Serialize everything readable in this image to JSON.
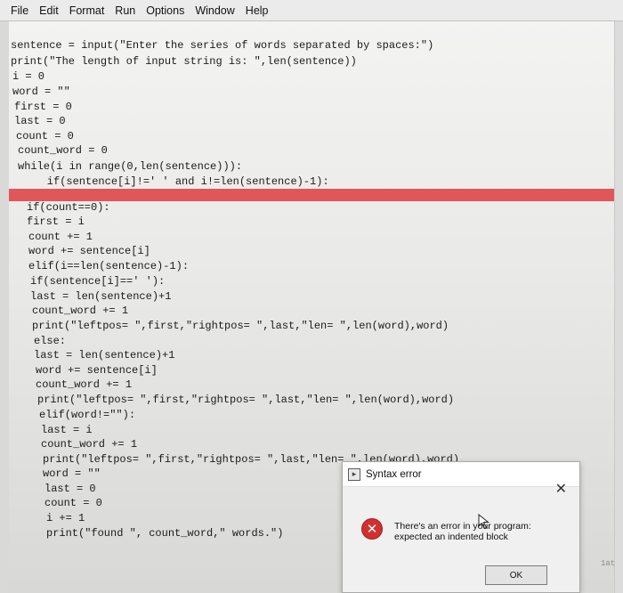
{
  "menubar": {
    "items": [
      "File",
      "Edit",
      "Format",
      "Run",
      "Options",
      "Window",
      "Help"
    ]
  },
  "code": {
    "lines": [
      "sentence = input(\"Enter the series of words separated by spaces:\")",
      "print(\"The length of input string is: \",len(sentence))",
      "i = 0",
      "word = \"\"",
      "first = 0",
      "last = 0",
      "count = 0",
      "count_word = 0",
      "while(i in range(0,len(sentence))):",
      "    if(sentence[i]!=' ' and i!=len(sentence)-1):",
      "",
      "if(count==0):",
      "first = i",
      "count += 1",
      "word += sentence[i]",
      "elif(i==len(sentence)-1):",
      "if(sentence[i]==' '):",
      "last = len(sentence)+1",
      "count_word += 1",
      "print(\"leftpos= \",first,\"rightpos= \",last,\"len= \",len(word),word)",
      "else:",
      "last = len(sentence)+1",
      "word += sentence[i]",
      "count_word += 1",
      "print(\"leftpos= \",first,\"rightpos= \",last,\"len= \",len(word),word)",
      "elif(word!=\"\"):",
      "last = i",
      "count_word += 1",
      "print(\"leftpos= \",first,\"rightpos= \",last,\"len= \",len(word),word)",
      "word = \"\"",
      "last = 0",
      "count = 0",
      "i += 1",
      "print(\"found \", count_word,\" words.\")"
    ]
  },
  "dialog": {
    "title": "Syntax error",
    "close_glyph": "✕",
    "message": "There's an error in your program: expected an indented block",
    "ok_label": "OK",
    "icon": "error-icon"
  },
  "edge_text": "1at"
}
